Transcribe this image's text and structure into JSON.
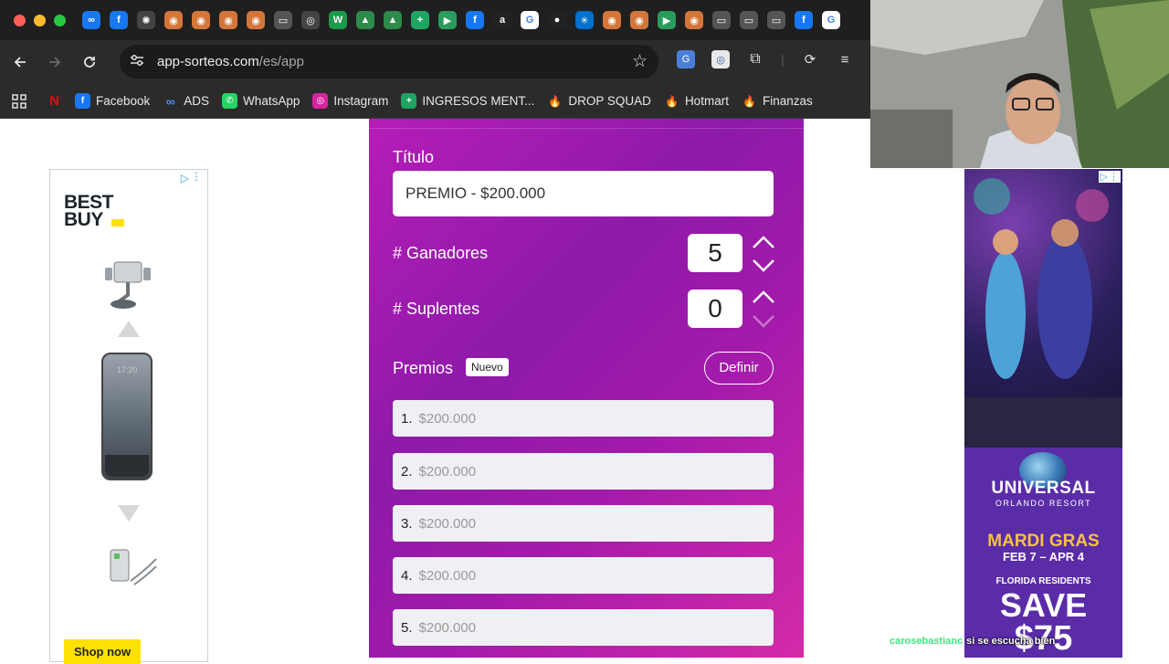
{
  "browser": {
    "tab_icon_names": [
      "meta-icon",
      "facebook-icon",
      "openai-icon",
      "tab-icon",
      "tab-icon",
      "tab-icon",
      "tab-icon",
      "chat-icon",
      "chrome-icon",
      "w-icon",
      "drive-icon",
      "drive-icon",
      "sheets-icon",
      "meet-icon",
      "facebook-icon",
      "amazon-icon",
      "google-icon",
      "circle-icon",
      "walmart-icon",
      "tab-icon",
      "tab-icon",
      "meet-icon",
      "tab-icon",
      "chat-icon",
      "chat-icon",
      "chat-icon",
      "facebook-icon",
      "google-icon"
    ],
    "url_host": "app-sorteos.com",
    "url_path": "/es/app",
    "bookmarks": [
      {
        "label": "",
        "icon": "netflix-icon"
      },
      {
        "label": "Facebook",
        "icon": "facebook-icon"
      },
      {
        "label": "ADS",
        "icon": "meta-icon"
      },
      {
        "label": "WhatsApp",
        "icon": "whatsapp-icon"
      },
      {
        "label": "Instagram",
        "icon": "instagram-icon"
      },
      {
        "label": "INGRESOS MENT...",
        "icon": "sheets-icon"
      },
      {
        "label": "DROP SQUAD",
        "icon": "flame-icon"
      },
      {
        "label": "Hotmart",
        "icon": "flame-icon"
      },
      {
        "label": "Finanzas",
        "icon": "flame-icon"
      }
    ]
  },
  "colors": {
    "panel_gradient_start": "#b51db7",
    "panel_gradient_end": "#d42aa8",
    "bestbuy_yellow": "#ffe000",
    "chat_user": "#3ee87d"
  },
  "form": {
    "titulo_label": "Título",
    "titulo_value": "PREMIO - $200.000",
    "ganadores_label": "# Ganadores",
    "ganadores_value": "5",
    "suplentes_label": "# Suplentes",
    "suplentes_value": "0",
    "premios_label": "Premios",
    "nuevo_badge": "Nuevo",
    "definir_button": "Definir",
    "prizes": [
      {
        "num": "1.",
        "value": "$200.000"
      },
      {
        "num": "2.",
        "value": "$200.000"
      },
      {
        "num": "3.",
        "value": "$200.000"
      },
      {
        "num": "4.",
        "value": "$200.000"
      },
      {
        "num": "5.",
        "value": "$200.000"
      }
    ]
  },
  "ad_left": {
    "brand_line1": "BEST",
    "brand_line2": "BUY",
    "phone_clock": "17:20",
    "cta": "Shop now"
  },
  "ad_right": {
    "brand": "UNIVERSAL",
    "sub": "ORLANDO RESORT",
    "event": "MARDI GRAS",
    "dates": "FEB 7 – APR 4",
    "residents": "FLORIDA RESIDENTS",
    "save": "SAVE",
    "amount": "$75"
  },
  "chat": {
    "user": "carosebastianc",
    "message": "si se escucha bien"
  }
}
